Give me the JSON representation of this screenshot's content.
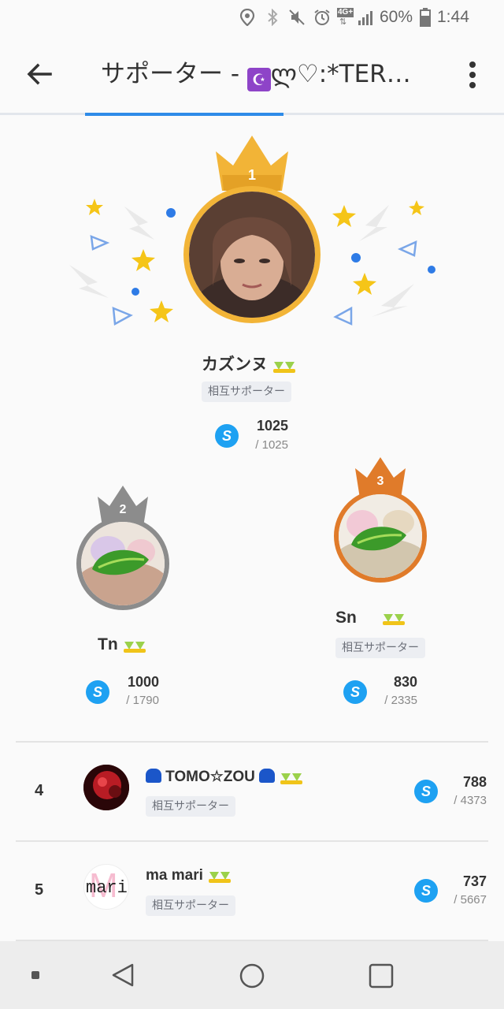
{
  "status_bar": {
    "network": "4G+",
    "battery_percent": "60%",
    "time": "1:44"
  },
  "header": {
    "title_prefix": "サポーター - ",
    "title_suffix": "ლ♡:*TER…",
    "moon_glyph": "☪"
  },
  "podium": {
    "first": {
      "rank": "1",
      "name": "カズンヌ",
      "tag": "相互サポーター",
      "amount": "1025",
      "total": "/ 1025"
    },
    "second": {
      "rank": "2",
      "name": "Tn",
      "amount": "1000",
      "total": "/ 1790"
    },
    "third": {
      "rank": "3",
      "name": "Sn",
      "tag": "相互サポーター",
      "amount": "830",
      "total": "/ 2335"
    }
  },
  "list": [
    {
      "rank": "4",
      "name": "TOMO☆ZOU",
      "tag": "相互サポーター",
      "amount": "788",
      "total": "/ 4373"
    },
    {
      "rank": "5",
      "name": "ma mari",
      "avatar_text": "mari",
      "tag": "相互サポーター",
      "amount": "737",
      "total": "/ 5667"
    }
  ],
  "s_icon_letter": "S",
  "colors": {
    "gold": "#f2b437",
    "silver": "#8c8c8c",
    "bronze": "#e07b2a",
    "accent_blue": "#2e8be8",
    "s_icon": "#1ea1f2"
  }
}
